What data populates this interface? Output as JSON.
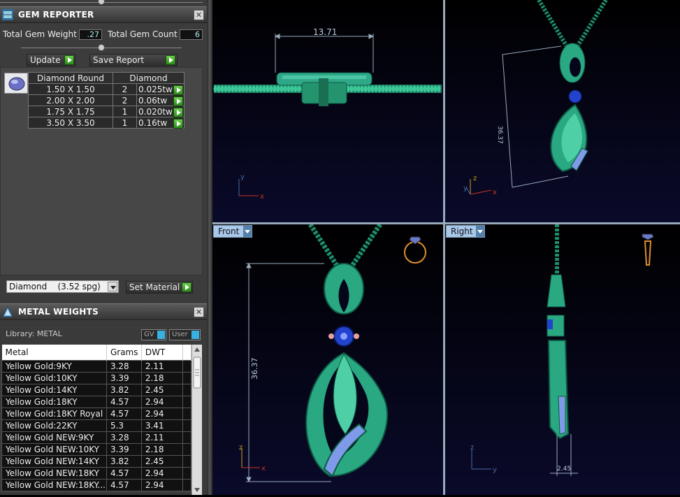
{
  "gem_reporter": {
    "title": "GEM REPORTER",
    "total_weight_label": "Total Gem Weight",
    "total_weight_value": ".27",
    "total_count_label": "Total Gem Count",
    "total_count_value": "6",
    "update_label": "Update",
    "save_report_label": "Save Report",
    "table": {
      "headers": [
        "Diamond Round",
        "Diamond"
      ],
      "rows": [
        {
          "size": "1.50 X 1.50",
          "count": "2",
          "weight": "0.025tw"
        },
        {
          "size": "2.00 X 2.00",
          "count": "2",
          "weight": "0.06tw"
        },
        {
          "size": "1.75 X 1.75",
          "count": "1",
          "weight": "0.020tw"
        },
        {
          "size": "3.50 X 3.50",
          "count": "1",
          "weight": "0.16tw"
        }
      ]
    },
    "material_value": "Diamond    (3.52 spg)",
    "set_material_label": "Set Material"
  },
  "metal_weights": {
    "title": "METAL WEIGHTS",
    "library_label": "Library: METAL",
    "gv_label": "GV",
    "user_label": "User",
    "headers": [
      "Metal",
      "Grams",
      "DWT"
    ],
    "rows": [
      [
        "Yellow Gold:9KY",
        "3.28",
        "2.11"
      ],
      [
        "Yellow Gold:10KY",
        "3.39",
        "2.18"
      ],
      [
        "Yellow Gold:14KY",
        "3.82",
        "2.45"
      ],
      [
        "Yellow Gold:18KY",
        "4.57",
        "2.94"
      ],
      [
        "Yellow Gold:18KY Royal",
        "4.57",
        "2.94"
      ],
      [
        "Yellow Gold:22KY",
        "5.3",
        "3.41"
      ],
      [
        "Yellow Gold NEW:9KY",
        "3.28",
        "2.11"
      ],
      [
        "Yellow Gold NEW:10KY",
        "3.39",
        "2.18"
      ],
      [
        "Yellow Gold NEW:14KY",
        "3.82",
        "2.45"
      ],
      [
        "Yellow Gold NEW:18KY",
        "4.57",
        "2.94"
      ],
      [
        "Yellow Gold NEW:18KY...",
        "4.57",
        "2.94"
      ]
    ]
  },
  "viewports": {
    "top_dimension": "13.71",
    "persp_dimension": "36.37",
    "front_label": "Front",
    "front_dimension": "36.37",
    "right_label": "Right",
    "right_dimension": "2.45",
    "axis_x": "x",
    "axis_y": "y",
    "axis_z": "z"
  },
  "colors": {
    "metal": "#2aa882",
    "gem": "#2244cc",
    "axis_x": "#cc3322",
    "axis_y": "#4a6aa0",
    "axis_z": "#c8a020"
  }
}
